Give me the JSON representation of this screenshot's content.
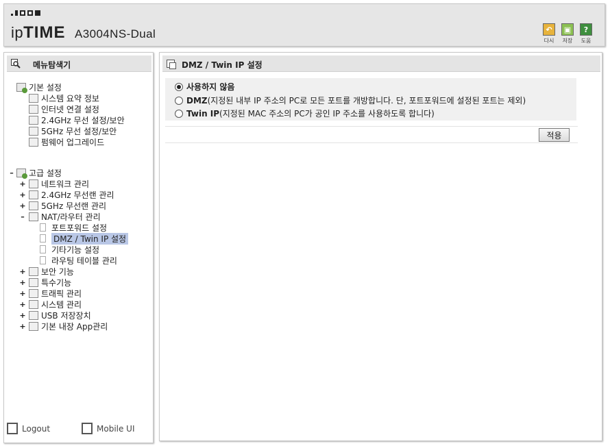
{
  "header": {
    "logo_prefix": "ip",
    "logo_main": "TIME",
    "model": "A3004NS-Dual",
    "tools": [
      {
        "label": "다시",
        "icon": "undo-icon",
        "color": "#e7b33c"
      },
      {
        "label": "저장",
        "icon": "save-icon",
        "color": "#8cc152"
      },
      {
        "label": "도움",
        "icon": "help-icon",
        "color": "#3f8f3f"
      }
    ]
  },
  "sidebar": {
    "title": "메뉴탐색기",
    "basic": {
      "label": "기본 설정",
      "items": [
        "시스템 요약 정보",
        "인터넷 연결 설정",
        "2.4GHz 무선 설정/보안",
        "5GHz 무선 설정/보안",
        "펌웨어 업그레이드"
      ]
    },
    "advanced": {
      "label": "고급 설정",
      "items": [
        "네트워크 관리",
        "2.4GHz 무선랜 관리",
        "5GHz 무선랜 관리",
        "NAT/라우터 관리"
      ],
      "nat_children": [
        "포트포워드 설정",
        "DMZ / Twin IP 설정",
        "기타기능 설정",
        "라우팅 테이블 관리"
      ],
      "more": [
        "보안 기능",
        "특수기능",
        "트래픽 관리",
        "시스템 관리",
        "USB 저장장치",
        "기본 내장 App관리"
      ]
    },
    "footer": {
      "logout": "Logout",
      "mobile": "Mobile UI"
    }
  },
  "main": {
    "title": "DMZ / Twin IP 설정",
    "options": [
      {
        "label": "사용하지 않음",
        "desc": "",
        "selected": true
      },
      {
        "label": "DMZ",
        "desc": " (지정된 내부 IP 주소의 PC로 모든 포트를 개방합니다. 단, 포트포워드에 설정된 포트는 제외)",
        "selected": false
      },
      {
        "label": "Twin IP",
        "desc": " (지정된 MAC 주소의 PC가 공인 IP 주소를 사용하도록 합니다)",
        "selected": false
      }
    ],
    "apply_label": "적용"
  },
  "colors": {
    "selected_item_bg": "#b9c7e6",
    "panel_header": "#e4e4e4"
  }
}
